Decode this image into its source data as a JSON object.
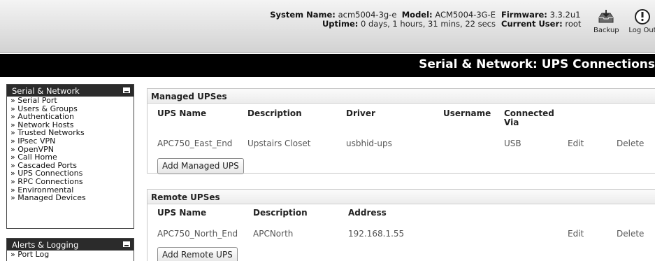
{
  "header": {
    "system_name_label": "System Name:",
    "system_name": "acm5004-3g-e",
    "model_label": "Model:",
    "model": "ACM5004-3G-E",
    "firmware_label": "Firmware:",
    "firmware": "3.3.2u1",
    "uptime_label": "Uptime:",
    "uptime": "0 days, 1 hours, 31 mins, 22 secs",
    "current_user_label": "Current User:",
    "current_user": "root",
    "backup_label": "Backup",
    "logout_label": "Log Out",
    "backup_icon": "backup-icon",
    "logout_icon": "power-icon"
  },
  "page_title": "Serial & Network: UPS Connections",
  "sidebar": {
    "serial_network": {
      "title": "Serial & Network",
      "items": [
        "» Serial Port",
        "» Users & Groups",
        "» Authentication",
        "» Network Hosts",
        "» Trusted Networks",
        "» IPsec VPN",
        "» OpenVPN",
        "» Call Home",
        "» Cascaded Ports",
        "» UPS Connections",
        "» RPC Connections",
        "» Environmental",
        "» Managed Devices"
      ]
    },
    "alerts_logging": {
      "title": "Alerts & Logging",
      "items": [
        "» Port Log"
      ]
    }
  },
  "managed": {
    "title": "Managed UPSes",
    "columns": {
      "ups_name": "UPS Name",
      "description": "Description",
      "driver": "Driver",
      "username": "Username",
      "connected_line1": "Connected",
      "connected_line2": "Via"
    },
    "rows": [
      {
        "ups_name": "APC750_East_End",
        "description": "Upstairs Closet",
        "driver": "usbhid-ups",
        "username": "",
        "connected_via": "USB",
        "edit": "Edit",
        "delete": "Delete"
      }
    ],
    "add_button": "Add Managed UPS"
  },
  "remote": {
    "title": "Remote UPSes",
    "columns": {
      "ups_name": "UPS Name",
      "description": "Description",
      "address": "Address"
    },
    "rows": [
      {
        "ups_name": "APC750_North_End",
        "description": "APCNorth",
        "address": "192.168.1.55",
        "edit": "Edit",
        "delete": "Delete"
      }
    ],
    "add_button": "Add Remote UPS"
  }
}
